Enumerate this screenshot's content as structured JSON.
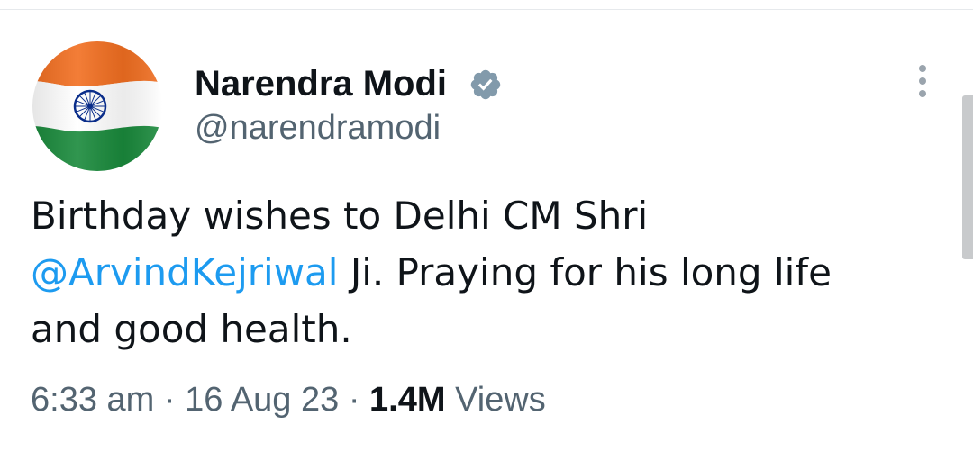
{
  "tweet": {
    "author": {
      "display_name": "Narendra Modi",
      "handle": "@narendramodi",
      "verified": true,
      "avatar_icon": "indian-flag-avatar"
    },
    "text": {
      "line1": "Birthday wishes to Delhi CM Shri",
      "mention": "@ArvindKejriwal",
      "line2_rest": " Ji. Praying for his long life",
      "line3": "and good health."
    },
    "meta": {
      "time": "6:33 am",
      "separator": " · ",
      "date": "16 Aug 23",
      "views_count": "1.4M",
      "views_label": " Views"
    },
    "more_icon": "vertical-ellipsis-icon"
  },
  "colors": {
    "text_primary": "#0f1419",
    "text_secondary": "#536471",
    "link": "#1d9bf0",
    "verified_badge": "#829aab",
    "flag_saffron": "#f26f21",
    "flag_green": "#1a8a3c",
    "flag_chakra": "#0a2d8a"
  }
}
